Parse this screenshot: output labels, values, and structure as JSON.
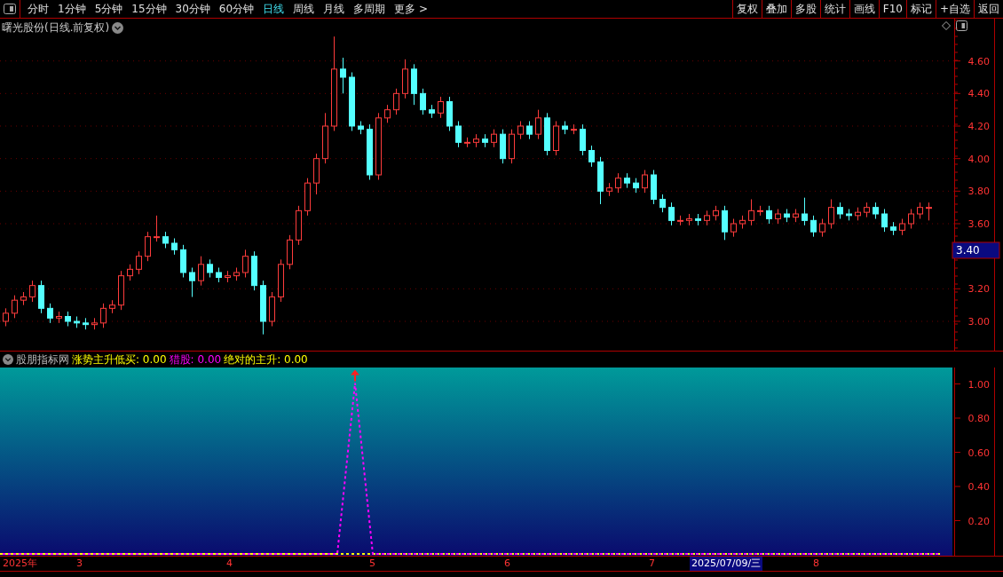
{
  "toolbar": {
    "periods": [
      {
        "label": "分时",
        "selected": false
      },
      {
        "label": "1分钟",
        "selected": false
      },
      {
        "label": "5分钟",
        "selected": false
      },
      {
        "label": "15分钟",
        "selected": false
      },
      {
        "label": "30分钟",
        "selected": false
      },
      {
        "label": "60分钟",
        "selected": false
      },
      {
        "label": "日线",
        "selected": true
      },
      {
        "label": "周线",
        "selected": false
      },
      {
        "label": "月线",
        "selected": false
      },
      {
        "label": "多周期",
        "selected": false
      },
      {
        "label": "更多 >",
        "selected": false
      }
    ],
    "buttons": [
      "复权",
      "叠加",
      "多股",
      "统计",
      "画线",
      "F10",
      "标记",
      "+自选",
      "返回"
    ]
  },
  "price_panel": {
    "title": "曙光股份(日线.前复权)",
    "cursor_price": "3.40",
    "chart_data": {
      "type": "candlestick",
      "ylim": [
        2.82,
        4.86
      ],
      "grid": true,
      "yticks": [
        {
          "value": 4.6,
          "label": "4.60"
        },
        {
          "value": 4.4,
          "label": "4.40"
        },
        {
          "value": 4.2,
          "label": "4.20"
        },
        {
          "value": 4.0,
          "label": "4.00"
        },
        {
          "value": 3.8,
          "label": "3.80"
        },
        {
          "value": 3.6,
          "label": "3.60"
        },
        {
          "value": 3.2,
          "label": "3.20"
        },
        {
          "value": 3.0,
          "label": "3.00"
        }
      ],
      "ohlc": [
        [
          3.0,
          3.08,
          2.97,
          3.05
        ],
        [
          3.05,
          3.16,
          3.02,
          3.13
        ],
        [
          3.13,
          3.18,
          3.1,
          3.15
        ],
        [
          3.15,
          3.25,
          3.12,
          3.22
        ],
        [
          3.22,
          3.25,
          3.05,
          3.08
        ],
        [
          3.08,
          3.11,
          2.99,
          3.02
        ],
        [
          3.02,
          3.06,
          2.99,
          3.03
        ],
        [
          3.03,
          3.06,
          2.97,
          3.0
        ],
        [
          3.0,
          3.03,
          2.96,
          2.99
        ],
        [
          2.99,
          3.02,
          2.95,
          2.98
        ],
        [
          2.98,
          3.02,
          2.95,
          2.99
        ],
        [
          2.99,
          3.11,
          2.96,
          3.08
        ],
        [
          3.08,
          3.13,
          3.05,
          3.1
        ],
        [
          3.1,
          3.31,
          3.07,
          3.28
        ],
        [
          3.28,
          3.35,
          3.25,
          3.32
        ],
        [
          3.32,
          3.43,
          3.29,
          3.4
        ],
        [
          3.4,
          3.55,
          3.37,
          3.52
        ],
        [
          3.52,
          3.65,
          3.49,
          3.52
        ],
        [
          3.52,
          3.55,
          3.45,
          3.48
        ],
        [
          3.48,
          3.51,
          3.41,
          3.44
        ],
        [
          3.44,
          3.47,
          3.27,
          3.3
        ],
        [
          3.3,
          3.33,
          3.15,
          3.25
        ],
        [
          3.25,
          3.4,
          3.22,
          3.35
        ],
        [
          3.35,
          3.38,
          3.27,
          3.3
        ],
        [
          3.3,
          3.33,
          3.24,
          3.27
        ],
        [
          3.27,
          3.31,
          3.24,
          3.28
        ],
        [
          3.28,
          3.33,
          3.25,
          3.3
        ],
        [
          3.3,
          3.44,
          3.27,
          3.4
        ],
        [
          3.4,
          3.43,
          3.19,
          3.22
        ],
        [
          3.22,
          3.25,
          2.92,
          3.0
        ],
        [
          3.0,
          3.18,
          2.97,
          3.15
        ],
        [
          3.15,
          3.38,
          3.12,
          3.35
        ],
        [
          3.35,
          3.53,
          3.32,
          3.5
        ],
        [
          3.5,
          3.71,
          3.47,
          3.68
        ],
        [
          3.68,
          3.88,
          3.65,
          3.85
        ],
        [
          3.85,
          4.03,
          3.78,
          4.0
        ],
        [
          4.0,
          4.28,
          3.97,
          4.2
        ],
        [
          4.2,
          4.75,
          4.17,
          4.55
        ],
        [
          4.55,
          4.62,
          4.4,
          4.5
        ],
        [
          4.5,
          4.53,
          4.17,
          4.2
        ],
        [
          4.2,
          4.23,
          4.15,
          4.18
        ],
        [
          4.18,
          4.21,
          3.87,
          3.9
        ],
        [
          3.9,
          4.28,
          3.87,
          4.25
        ],
        [
          4.25,
          4.33,
          4.22,
          4.3
        ],
        [
          4.3,
          4.43,
          4.27,
          4.4
        ],
        [
          4.4,
          4.61,
          4.37,
          4.55
        ],
        [
          4.55,
          4.58,
          4.33,
          4.4
        ],
        [
          4.4,
          4.43,
          4.27,
          4.3
        ],
        [
          4.3,
          4.33,
          4.25,
          4.28
        ],
        [
          4.28,
          4.38,
          4.25,
          4.35
        ],
        [
          4.35,
          4.38,
          4.17,
          4.2
        ],
        [
          4.2,
          4.23,
          4.07,
          4.1
        ],
        [
          4.1,
          4.13,
          4.07,
          4.1
        ],
        [
          4.1,
          4.15,
          4.07,
          4.12
        ],
        [
          4.12,
          4.15,
          4.07,
          4.1
        ],
        [
          4.1,
          4.18,
          4.07,
          4.15
        ],
        [
          4.15,
          4.18,
          3.97,
          4.0
        ],
        [
          4.0,
          4.18,
          3.97,
          4.15
        ],
        [
          4.15,
          4.23,
          4.12,
          4.2
        ],
        [
          4.2,
          4.23,
          4.12,
          4.15
        ],
        [
          4.15,
          4.3,
          4.12,
          4.25
        ],
        [
          4.25,
          4.28,
          4.02,
          4.05
        ],
        [
          4.05,
          4.23,
          4.02,
          4.2
        ],
        [
          4.2,
          4.23,
          4.15,
          4.18
        ],
        [
          4.18,
          4.21,
          4.15,
          4.18
        ],
        [
          4.18,
          4.21,
          4.02,
          4.05
        ],
        [
          4.05,
          4.08,
          3.95,
          3.98
        ],
        [
          3.98,
          4.01,
          3.72,
          3.8
        ],
        [
          3.8,
          3.85,
          3.77,
          3.82
        ],
        [
          3.82,
          3.91,
          3.79,
          3.88
        ],
        [
          3.88,
          3.91,
          3.82,
          3.85
        ],
        [
          3.85,
          3.88,
          3.79,
          3.82
        ],
        [
          3.82,
          3.93,
          3.79,
          3.9
        ],
        [
          3.9,
          3.93,
          3.72,
          3.75
        ],
        [
          3.75,
          3.78,
          3.67,
          3.7
        ],
        [
          3.7,
          3.73,
          3.59,
          3.62
        ],
        [
          3.62,
          3.65,
          3.59,
          3.62
        ],
        [
          3.62,
          3.66,
          3.59,
          3.63
        ],
        [
          3.63,
          3.66,
          3.59,
          3.62
        ],
        [
          3.62,
          3.68,
          3.59,
          3.65
        ],
        [
          3.65,
          3.71,
          3.62,
          3.68
        ],
        [
          3.68,
          3.71,
          3.5,
          3.55
        ],
        [
          3.55,
          3.63,
          3.52,
          3.6
        ],
        [
          3.6,
          3.65,
          3.57,
          3.62
        ],
        [
          3.62,
          3.75,
          3.59,
          3.68
        ],
        [
          3.68,
          3.71,
          3.65,
          3.68
        ],
        [
          3.68,
          3.71,
          3.6,
          3.63
        ],
        [
          3.63,
          3.69,
          3.6,
          3.66
        ],
        [
          3.66,
          3.69,
          3.61,
          3.64
        ],
        [
          3.64,
          3.69,
          3.61,
          3.66
        ],
        [
          3.66,
          3.76,
          3.59,
          3.62
        ],
        [
          3.62,
          3.65,
          3.52,
          3.55
        ],
        [
          3.55,
          3.63,
          3.52,
          3.6
        ],
        [
          3.6,
          3.75,
          3.57,
          3.7
        ],
        [
          3.7,
          3.73,
          3.63,
          3.66
        ],
        [
          3.66,
          3.69,
          3.62,
          3.65
        ],
        [
          3.65,
          3.7,
          3.62,
          3.67
        ],
        [
          3.67,
          3.73,
          3.64,
          3.7
        ],
        [
          3.7,
          3.73,
          3.63,
          3.66
        ],
        [
          3.66,
          3.69,
          3.55,
          3.58
        ],
        [
          3.58,
          3.61,
          3.53,
          3.56
        ],
        [
          3.56,
          3.63,
          3.53,
          3.6
        ],
        [
          3.6,
          3.69,
          3.57,
          3.66
        ],
        [
          3.66,
          3.73,
          3.63,
          3.7
        ],
        [
          3.7,
          3.73,
          3.62,
          3.7
        ]
      ]
    }
  },
  "indicator_panel": {
    "name": "股朋指标网",
    "readings": [
      ": 0.00",
      ": 0.00"
    ],
    "other_readouts": [
      {
        "label": "绝对的主升: 0.00",
        "color": "#ffff00"
      }
    ],
    "chart_data": {
      "type": "line",
      "ylim": [
        0,
        1.1
      ],
      "yticks": [
        {
          "value": 0.2,
          "label": "0.20"
        },
        {
          "value": 0.4,
          "label": "0.40"
        },
        {
          "value": 0.6,
          "label": "0.60"
        },
        {
          "value": 0.8,
          "label": "0.80"
        },
        {
          "value": 1.0,
          "label": "1.00"
        }
      ],
      "series": [
        {
          "name": "涨势主升低买",
          "color": "#ffff00",
          "line_style": "dashed",
          "values": [
            0,
            0,
            0,
            0,
            0,
            0,
            0,
            0,
            0,
            0,
            0,
            0,
            0,
            0,
            0,
            0,
            0,
            0,
            0,
            0,
            0,
            0,
            0,
            0,
            0,
            0,
            0,
            0,
            0,
            0,
            0,
            0,
            0,
            0,
            0,
            0,
            0,
            0,
            0,
            0,
            0,
            0,
            0,
            0,
            0,
            0,
            0,
            0,
            0,
            0,
            0,
            0,
            0,
            0
          ]
        },
        {
          "name": "猎股",
          "color": "#ff00ff",
          "line_style": "dashed",
          "values": [
            0,
            0,
            0,
            0,
            0,
            0,
            0,
            0,
            0,
            0,
            0,
            0,
            0,
            0,
            0,
            0,
            0,
            0,
            0,
            0,
            1,
            0,
            0,
            0,
            0,
            0,
            0,
            0,
            0,
            0,
            0,
            0,
            0,
            0,
            0,
            0,
            0,
            0,
            0,
            0,
            0,
            0,
            0,
            0,
            0,
            0,
            0,
            0,
            0,
            0,
            0,
            0,
            0,
            0
          ]
        }
      ]
    }
  },
  "date_axis": [
    {
      "label": "2025年",
      "kind": "tick"
    },
    {
      "label": "3",
      "kind": "tick"
    },
    {
      "label": "4",
      "kind": "tick"
    },
    {
      "label": "5",
      "kind": "tick"
    },
    {
      "label": "6",
      "kind": "tick"
    },
    {
      "label": "7",
      "kind": "tick"
    },
    {
      "label": "2025/07/09/三",
      "kind": "cursor"
    },
    {
      "label": "8",
      "kind": "tick"
    }
  ]
}
